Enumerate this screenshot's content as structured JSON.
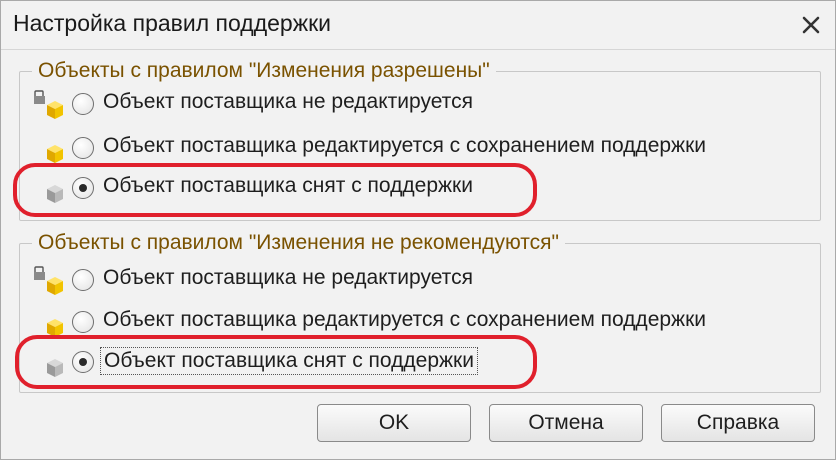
{
  "window": {
    "title": "Настройка правил поддержки",
    "close_icon": "close-icon"
  },
  "groups": [
    {
      "legend": "Объекты с правилом \"Изменения разрешены\"",
      "options": [
        {
          "label": "Объект поставщика не редактируется",
          "icon": "locked-cube-icon",
          "selected": false
        },
        {
          "label": "Объект поставщика редактируется с сохранением поддержки",
          "icon": "cube-icon",
          "selected": false
        },
        {
          "label": "Объект поставщика снят с поддержки",
          "icon": "gray-cube-icon",
          "selected": true
        }
      ]
    },
    {
      "legend": "Объекты с правилом \"Изменения не рекомендуются\"",
      "options": [
        {
          "label": "Объект поставщика не редактируется",
          "icon": "locked-cube-icon",
          "selected": false
        },
        {
          "label": "Объект поставщика редактируется с сохранением поддержки",
          "icon": "cube-icon",
          "selected": false
        },
        {
          "label": "Объект поставщика снят с поддержки",
          "icon": "gray-cube-icon",
          "selected": true
        }
      ]
    }
  ],
  "buttons": {
    "ok": "OK",
    "cancel": "Отмена",
    "help": "Справка"
  },
  "colors": {
    "legend_text": "#7a5200",
    "highlight": "#e0202c",
    "cube_yellow": "#f2c400"
  }
}
